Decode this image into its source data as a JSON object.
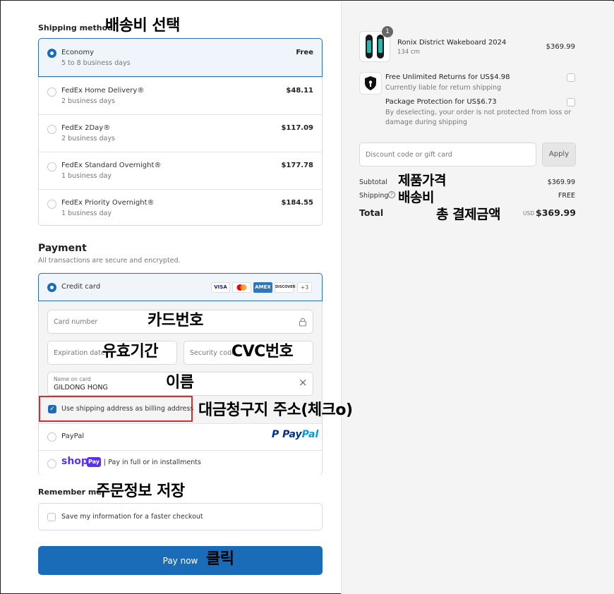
{
  "shipping": {
    "title": "Shipping method",
    "annotation": "배송비 선택",
    "options": [
      {
        "name": "Economy",
        "sub": "5 to 8 business days",
        "price": "Free",
        "selected": true
      },
      {
        "name": "FedEx Home Delivery®",
        "sub": "2 business days",
        "price": "$48.11",
        "selected": false
      },
      {
        "name": "FedEx 2Day®",
        "sub": "2 business days",
        "price": "$117.09",
        "selected": false
      },
      {
        "name": "FedEx Standard Overnight®",
        "sub": "1 business day",
        "price": "$177.78",
        "selected": false
      },
      {
        "name": "FedEx Priority Overnight®",
        "sub": "1 business day",
        "price": "$184.55",
        "selected": false
      }
    ]
  },
  "payment": {
    "title": "Payment",
    "subtitle": "All transactions are secure and encrypted.",
    "credit_card_label": "Credit card",
    "card_logos": [
      "VISA",
      "",
      "AMEX",
      "DISCOVER"
    ],
    "more_cards": "+3",
    "card_number_placeholder": "Card number",
    "card_number_annotation": "카드번호",
    "expiration_placeholder": "Expiration date",
    "expiration_annotation": "유효기간",
    "security_placeholder": "Security code",
    "security_annotation": "CVC번호",
    "name_label": "Name on card",
    "name_value": "GILDONG HONG",
    "name_annotation": "이름",
    "billing_label": "Use shipping address as billing address",
    "billing_annotation": "대금청구지 주소(체크o)",
    "paypal_label": "PayPal",
    "paypal_logo_p": "P",
    "paypal_logo_pay": "Pay",
    "paypal_logo_pal": "Pal",
    "shop_logo": "shop",
    "shop_pay_badge": "Pay",
    "shop_label": "| Pay in full or in installments"
  },
  "remember": {
    "title": "Remember me",
    "annotation": "주문정보 저장",
    "label": "Save my information for a faster checkout"
  },
  "pay_button": {
    "label": "Pay now",
    "annotation": "클릭"
  },
  "summary": {
    "product_name": "Ronix District Wakeboard 2024",
    "product_variant": "134 cm",
    "product_price": "$369.99",
    "quantity_badge": "1",
    "addon1_title": "Free Unlimited Returns for US$4.98",
    "addon1_sub": "Currently liable for return shipping",
    "addon2_title": "Package Protection for US$6.73",
    "addon2_sub_line1": "By deselecting, your order is not protected from loss or",
    "addon2_sub_line2": "damage during shipping",
    "discount_placeholder": "Discount code or gift card",
    "apply_label": "Apply",
    "subtotal_label": "Subtotal",
    "subtotal_annotation": "제품가격",
    "subtotal_value": "$369.99",
    "shipping_label": "Shipping",
    "shipping_annotation": "배송비",
    "shipping_value": "FREE",
    "total_label": "Total",
    "total_annotation": "총 결제금액",
    "total_currency": "USD",
    "total_value": "$369.99"
  },
  "colors": {
    "accent": "#1a6cb8",
    "highlight_box": "#d03030",
    "panel_bg": "#f4f4f4"
  }
}
